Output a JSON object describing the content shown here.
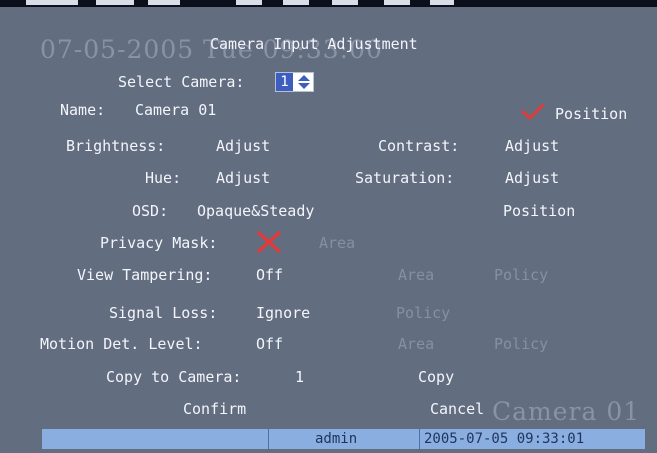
{
  "screen": {
    "title": "Camera Input Adjustment",
    "overlay_datetime": "07-05-2005 Tue 09:33:00",
    "overlay_camera": "Camera 01"
  },
  "select_camera": {
    "label": "Select Camera:",
    "value": "1"
  },
  "name": {
    "label": "Name:",
    "value": "Camera 01"
  },
  "position_top": {
    "checked": true,
    "label": "Position",
    "check_color": "#e03a3a"
  },
  "brightness": {
    "label": "Brightness:",
    "value": "Adjust"
  },
  "contrast": {
    "label": "Contrast:",
    "value": "Adjust"
  },
  "hue": {
    "label": "Hue:",
    "value": "Adjust"
  },
  "saturation": {
    "label": "Saturation:",
    "value": "Adjust"
  },
  "osd": {
    "label": "OSD:",
    "value": "Opaque&Steady",
    "position": "Position"
  },
  "privacy_mask": {
    "label": "Privacy Mask:",
    "checked": false,
    "area": "Area",
    "cross_color": "#e03a3a"
  },
  "view_tampering": {
    "label": "View Tampering:",
    "value": "Off",
    "area": "Area",
    "policy": "Policy"
  },
  "signal_loss": {
    "label": "Signal Loss:",
    "value": "Ignore",
    "policy": "Policy"
  },
  "motion": {
    "label": "Motion Det. Level:",
    "value": "Off",
    "area": "Area",
    "policy": "Policy"
  },
  "copy": {
    "label": "Copy to Camera:",
    "value": "1",
    "button": "Copy"
  },
  "buttons": {
    "confirm": "Confirm",
    "cancel": "Cancel"
  },
  "status": {
    "user": "admin",
    "datetime": "2005-07-05 09:33:01"
  },
  "colors": {
    "background": "#636d80",
    "statusbar": "#8aaee0",
    "disabled_text": "#8690a5",
    "highlight": "#3d5ec0"
  }
}
